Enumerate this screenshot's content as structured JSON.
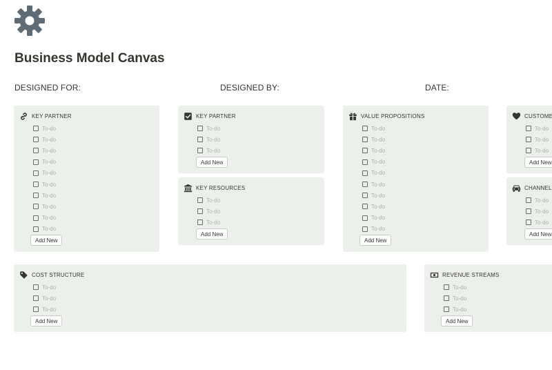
{
  "page": {
    "icon": "gear-icon",
    "title": "Business Model Canvas",
    "designed_for_label": "DESIGNED FOR:",
    "designed_by_label": "DESIGNED BY:",
    "date_label": "DATE:"
  },
  "colors": {
    "card_background": "#ecf0ea",
    "icon_color": "#37352f",
    "gear_color": "#5f6b75",
    "placeholder_text": "#aeaeab"
  },
  "cards": [
    {
      "key": "key-partner-1",
      "title": "KEY PARTNER",
      "icon": "link-icon",
      "todos": [
        "To-do",
        "To-do",
        "To-do",
        "To-do",
        "To-do",
        "To-do",
        "To-do",
        "To-do",
        "To-do",
        "To-do"
      ],
      "button": "Add New"
    },
    {
      "key": "key-partner-2",
      "title": "KEY PARTNER",
      "icon": "checkbox-checked-icon",
      "todos": [
        "To-do",
        "To-do",
        "To-do"
      ],
      "button": "Add New"
    },
    {
      "key": "key-resources",
      "title": "KEY RESOURCES",
      "icon": "bank-icon",
      "todos": [
        "To-do",
        "To-do",
        "To-do"
      ],
      "button": "Add New"
    },
    {
      "key": "value-propositions",
      "title": "VALUE PROPOSITIONS",
      "icon": "gift-icon",
      "todos": [
        "To-do",
        "To-do",
        "To-do",
        "To-do",
        "To-do",
        "To-do",
        "To-do",
        "To-do",
        "To-do",
        "To-do"
      ],
      "button": "Add New"
    },
    {
      "key": "customer",
      "title": "CUSTOMER",
      "icon": "heart-icon",
      "todos": [
        "To-do",
        "To-do",
        "To-do"
      ],
      "button": "Add New"
    },
    {
      "key": "channel",
      "title": "CHANNEL",
      "icon": "car-icon",
      "todos": [
        "To-do",
        "To-do",
        "To-do"
      ],
      "button": "Add New"
    },
    {
      "key": "cost-structure",
      "title": "COST STRUCTURE",
      "icon": "tag-icon",
      "todos": [
        "To-do",
        "To-do",
        "To-do"
      ],
      "button": "Add New"
    },
    {
      "key": "revenue-streams",
      "title": "REVENUE STREAMS",
      "icon": "money-icon",
      "todos": [
        "To-do",
        "To-do",
        "To-do"
      ],
      "button": "Add New"
    }
  ]
}
